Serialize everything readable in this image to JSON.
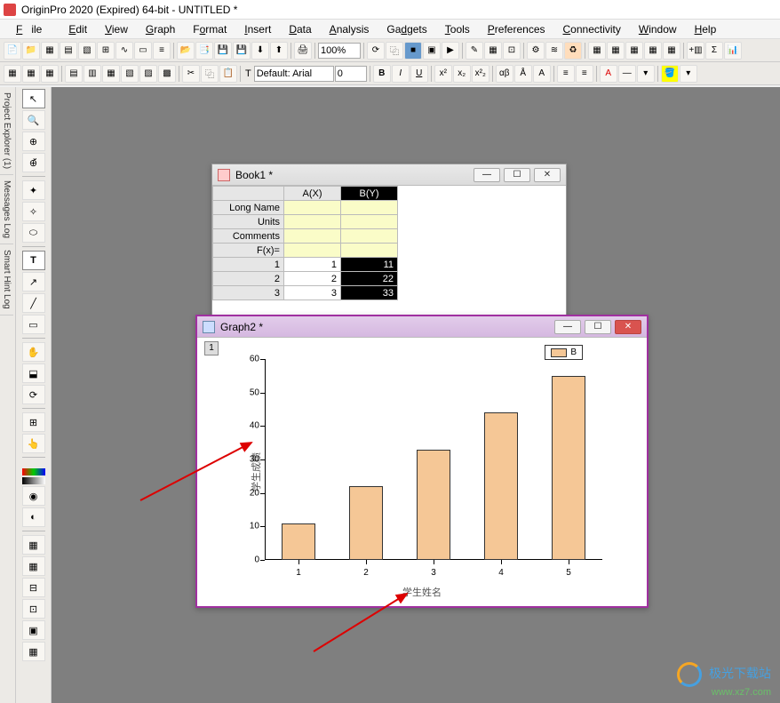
{
  "app": {
    "title": "OriginPro 2020 (Expired) 64-bit - UNTITLED *"
  },
  "menu": {
    "file": "File",
    "edit": "Edit",
    "view": "View",
    "graph": "Graph",
    "format": "Format",
    "insert": "Insert",
    "data": "Data",
    "analysis": "Analysis",
    "gadgets": "Gadgets",
    "tools": "Tools",
    "preferences": "Preferences",
    "connectivity": "Connectivity",
    "window": "Window",
    "help": "Help"
  },
  "toolbar1": {
    "zoom": "100%"
  },
  "toolbar2": {
    "font_prefix": "T",
    "font_name": "Default: Arial",
    "font_size": "0",
    "bold": "B",
    "italic": "I",
    "underline": "U",
    "sup": "x²",
    "sub": "x₂",
    "supsub": "x²₂",
    "alpha": "αβ",
    "abig": "Å",
    "asmall": "A",
    "line": "≡",
    "line2": "≡"
  },
  "left_tabs": {
    "project_explorer": "Project Explorer (1)",
    "messages": "Messages Log",
    "smart_hint": "Smart Hint Log"
  },
  "book": {
    "title": "Book1 *",
    "cols": [
      "A(X)",
      "B(Y)"
    ],
    "meta_rows": [
      "Long Name",
      "Units",
      "Comments",
      "F(x)="
    ],
    "rows": [
      {
        "idx": "1",
        "a": "1",
        "b": "11"
      },
      {
        "idx": "2",
        "a": "2",
        "b": "22"
      },
      {
        "idx": "3",
        "a": "3",
        "b": "33"
      }
    ]
  },
  "graph": {
    "title": "Graph2 *",
    "layer_tag": "1",
    "legend": "B",
    "xlabel": "学生姓名",
    "ylabel": "学生成绩"
  },
  "chart_data": {
    "type": "bar",
    "categories": [
      "1",
      "2",
      "3",
      "4",
      "5"
    ],
    "values": [
      11,
      22,
      33,
      44,
      55
    ],
    "series_name": "B",
    "title": "",
    "xlabel": "学生姓名",
    "ylabel": "学生成绩",
    "ylim": [
      0,
      60
    ],
    "yticks": [
      0,
      10,
      20,
      30,
      40,
      50,
      60
    ],
    "bar_color": "#f5c796"
  },
  "watermark": {
    "name": "极光下载站",
    "url": "www.xz7.com"
  }
}
